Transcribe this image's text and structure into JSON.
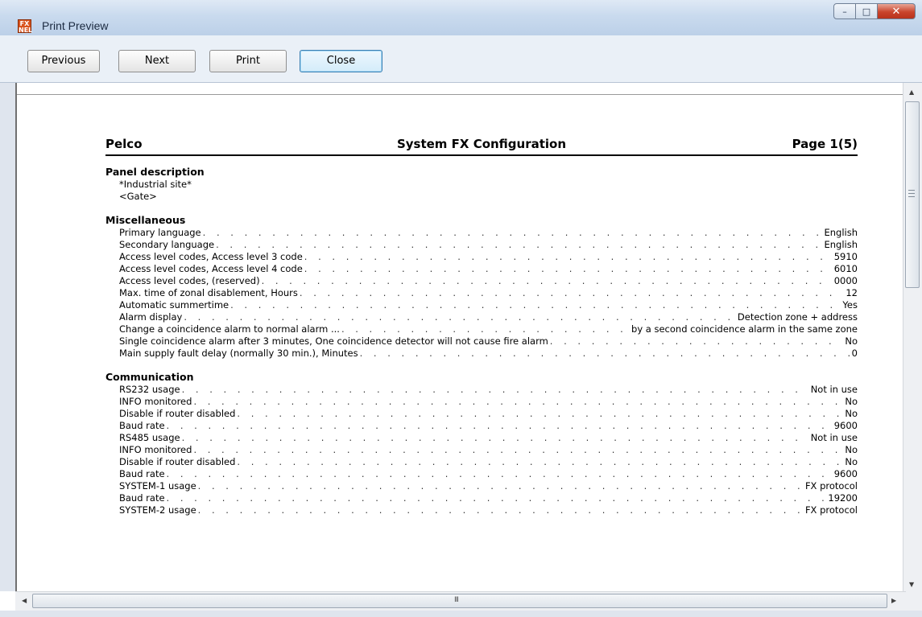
{
  "window": {
    "title": "Print Preview",
    "icon_text": "FX NEL"
  },
  "toolbar": {
    "previous": "Previous",
    "next": "Next",
    "print": "Print",
    "close": "Close"
  },
  "page": {
    "header_left": "Pelco",
    "header_center": "System FX Configuration",
    "header_right": "Page 1(5)",
    "panel_description": {
      "title": "Panel description",
      "lines": [
        "*Industrial site*",
        "<Gate>"
      ]
    },
    "miscellaneous": {
      "title": "Miscellaneous",
      "rows": [
        {
          "k": "Primary language",
          "v": "English"
        },
        {
          "k": "Secondary language",
          "v": "English"
        },
        {
          "k": "Access level codes, Access level 3 code",
          "v": "5910"
        },
        {
          "k": "Access level codes, Access level 4 code",
          "v": "6010"
        },
        {
          "k": "Access level codes, (reserved)",
          "v": "0000"
        },
        {
          "k": "Max. time of zonal disablement, Hours",
          "v": "12"
        },
        {
          "k": "Automatic summertime",
          "v": "Yes"
        },
        {
          "k": "Alarm display",
          "v": "Detection zone + address"
        },
        {
          "k": "Change a coincidence alarm to normal alarm ...",
          "v": "by a second coincidence alarm in the same zone"
        },
        {
          "k": "Single coincidence alarm after 3 minutes, One coincidence detector will not cause fire alarm",
          "v": "No"
        },
        {
          "k": "Main supply fault delay (normally 30 min.), Minutes",
          "v": "0"
        }
      ]
    },
    "communication": {
      "title": "Communication",
      "rows": [
        {
          "k": "RS232 usage",
          "v": "Not in use"
        },
        {
          "k": "INFO monitored",
          "v": "No"
        },
        {
          "k": "Disable if router disabled",
          "v": "No"
        },
        {
          "k": "Baud rate",
          "v": "9600"
        },
        {
          "k": "RS485 usage",
          "v": "Not in use"
        },
        {
          "k": "INFO monitored",
          "v": "No"
        },
        {
          "k": "Disable if router disabled",
          "v": "No"
        },
        {
          "k": "Baud rate",
          "v": "9600"
        },
        {
          "k": "SYSTEM-1 usage",
          "v": "FX protocol"
        },
        {
          "k": "Baud rate",
          "v": "19200"
        },
        {
          "k": "SYSTEM-2 usage",
          "v": "FX protocol"
        }
      ]
    }
  },
  "scrollbar": {
    "grip": "III"
  }
}
